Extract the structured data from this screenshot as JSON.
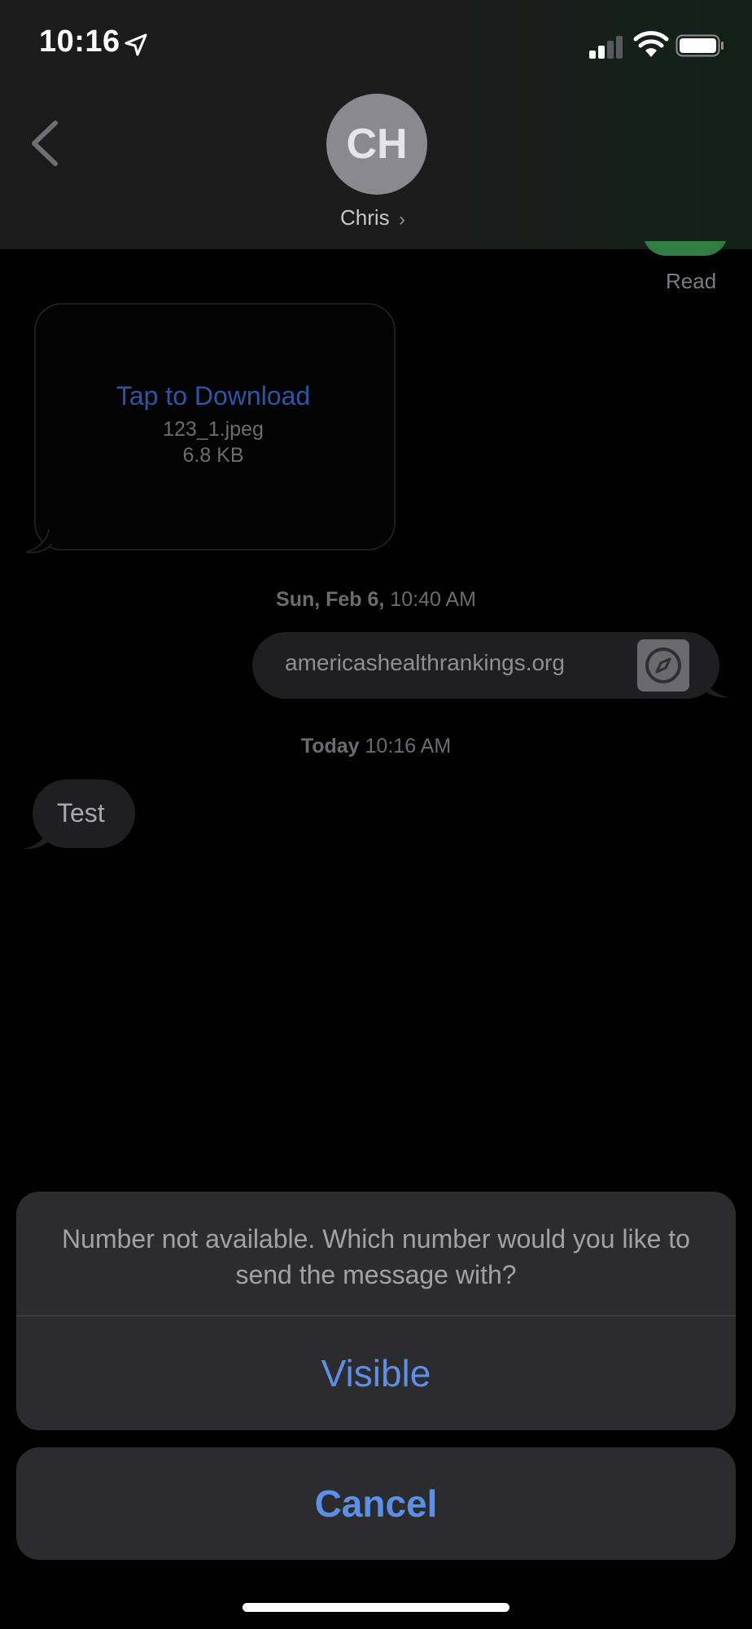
{
  "status_bar": {
    "time": "10:16",
    "location_icon": "location-arrow-icon",
    "signal_icon": "cellular-signal-icon",
    "wifi_icon": "wifi-icon",
    "battery_icon": "battery-icon"
  },
  "header": {
    "back_icon": "chevron-left-icon",
    "avatar_initials": "CH",
    "contact_name": "Chris",
    "contact_chevron": "›"
  },
  "messages": {
    "read_receipt": "Read",
    "attachment": {
      "action": "Tap to Download",
      "file_name": "123_1.jpeg",
      "file_size": "6.8 KB"
    },
    "timestamp_1": {
      "day": "Sun, Feb 6,",
      "time": "10:40 AM"
    },
    "link": {
      "text": "americashealthrankings.org",
      "icon": "safari-compass-icon"
    },
    "timestamp_2": {
      "day": "Today",
      "time": "10:16 AM"
    },
    "incoming_text": "Test"
  },
  "action_sheet": {
    "message": "Number not available. Which number would you like to send the message with?",
    "option": "Visible",
    "cancel": "Cancel"
  },
  "colors": {
    "accent_blue": "#5b8fe8",
    "sheet_background": "#2c2c2e",
    "bubble_background": "#1f1f21"
  }
}
